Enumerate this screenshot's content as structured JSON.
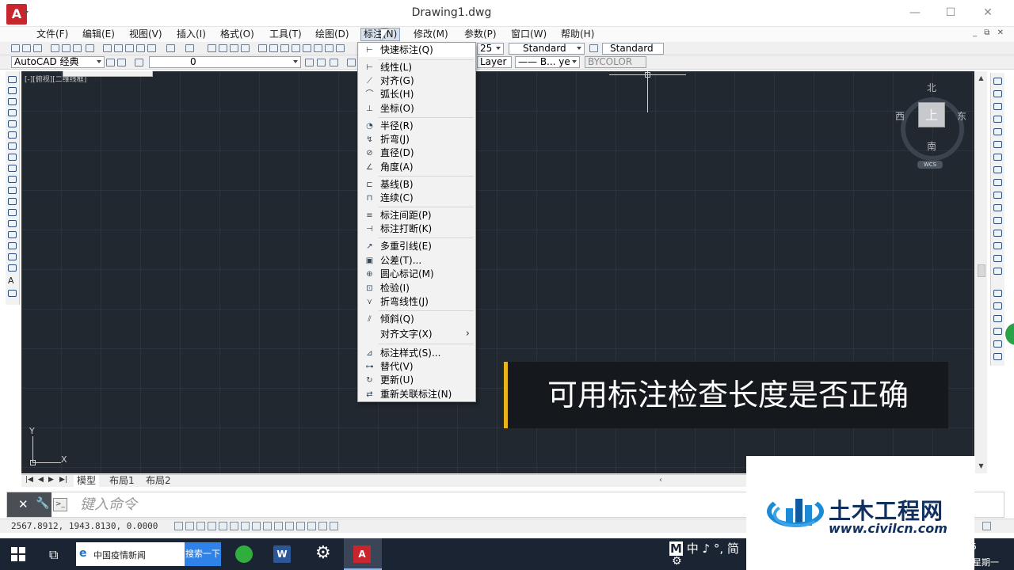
{
  "window": {
    "title": "Drawing1.dwg",
    "minimize": "—",
    "maximize": "☐",
    "close": "✕",
    "mdi_controls": "_ ⧉ ✕"
  },
  "menubar": {
    "items": [
      "文件(F)",
      "编辑(E)",
      "视图(V)",
      "插入(I)",
      "格式(O)",
      "工具(T)",
      "绘图(D)",
      "标注(N)",
      "修改(M)",
      "参数(P)",
      "窗口(W)",
      "帮助(H)"
    ],
    "active_index": 7
  },
  "toolbar": {
    "workspace": "AutoCAD 经典",
    "layer": "0",
    "text_style_partial": "25",
    "dim_style": "Standard",
    "table_style": "Standard",
    "linetype_partial": "Layer",
    "lineweight_partial": "—— B... ye",
    "plot_style": "BYCOLOR"
  },
  "canvas": {
    "viewport_label": "[-][俯视][二维线框]"
  },
  "viewcube": {
    "north": "北",
    "south": "南",
    "east": "东",
    "west": "西",
    "face": "上",
    "wcs": "WCS"
  },
  "ucs": {
    "x": "X",
    "y": "Y"
  },
  "caption": "可用标注检查长度是否正确",
  "dimension_menu": {
    "items": [
      {
        "icon": "quick-dimension-icon",
        "glyph": "⊢",
        "label": "快速标注(Q)"
      },
      {
        "icon": "linear-dimension-icon",
        "glyph": "⊢",
        "label": "线性(L)"
      },
      {
        "icon": "aligned-dimension-icon",
        "glyph": "⟋",
        "label": "对齐(G)"
      },
      {
        "icon": "arc-length-icon",
        "glyph": "⌒",
        "label": "弧长(H)"
      },
      {
        "icon": "ordinate-dimension-icon",
        "glyph": "⊥",
        "label": "坐标(O)"
      },
      {
        "icon": "radius-dimension-icon",
        "glyph": "◔",
        "label": "半径(R)"
      },
      {
        "icon": "jogged-dimension-icon",
        "glyph": "↯",
        "label": "折弯(J)"
      },
      {
        "icon": "diameter-dimension-icon",
        "glyph": "⊘",
        "label": "直径(D)"
      },
      {
        "icon": "angular-dimension-icon",
        "glyph": "∠",
        "label": "角度(A)"
      },
      {
        "icon": "baseline-dimension-icon",
        "glyph": "⊏",
        "label": "基线(B)"
      },
      {
        "icon": "continue-dimension-icon",
        "glyph": "⊓",
        "label": "连续(C)"
      },
      {
        "icon": "dimension-space-icon",
        "glyph": "≡",
        "label": "标注间距(P)"
      },
      {
        "icon": "dimension-break-icon",
        "glyph": "⊣",
        "label": "标注打断(K)"
      },
      {
        "icon": "multileader-icon",
        "glyph": "↗",
        "label": "多重引线(E)"
      },
      {
        "icon": "tolerance-icon",
        "glyph": "▣",
        "label": "公差(T)..."
      },
      {
        "icon": "center-mark-icon",
        "glyph": "⊕",
        "label": "圆心标记(M)"
      },
      {
        "icon": "inspection-icon",
        "glyph": "⊡",
        "label": "检验(I)"
      },
      {
        "icon": "jogged-linear-icon",
        "glyph": "⋎",
        "label": "折弯线性(J)"
      },
      {
        "icon": "oblique-icon",
        "glyph": "⫽",
        "label": "倾斜(Q)"
      },
      {
        "icon": "align-text-icon",
        "glyph": "",
        "label": "对齐文字(X)",
        "submenu": true
      },
      {
        "icon": "dimension-style-icon",
        "glyph": "⊿",
        "label": "标注样式(S)..."
      },
      {
        "icon": "override-icon",
        "glyph": "⊶",
        "label": "替代(V)"
      },
      {
        "icon": "update-icon",
        "glyph": "↻",
        "label": "更新(U)"
      },
      {
        "icon": "reassociate-icon",
        "glyph": "⇄",
        "label": "重新关联标注(N)"
      }
    ],
    "submenu_arrow": "›"
  },
  "layout_tabs": [
    "模型",
    "布局1",
    "布局2"
  ],
  "command_line": {
    "placeholder": "键入命令"
  },
  "status": {
    "coordinates": "2567.8912, 1943.8130, 0.0000"
  },
  "taskbar": {
    "search_text": "中国疫情新闻",
    "search_button": "搜索一下",
    "word_label": "W",
    "ime": "中 ♪ °, 简",
    "ime_m": "M",
    "clock_partial": "星期一",
    "tray_partial": "5"
  },
  "watermark": {
    "name": "土木工程网",
    "url": "www.civilcn.com"
  }
}
